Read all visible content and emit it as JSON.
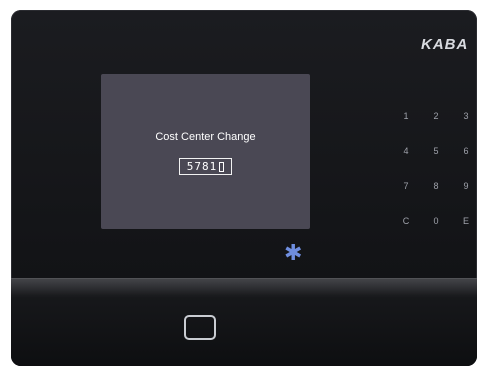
{
  "brand": {
    "logo_text": "KABA"
  },
  "screen": {
    "title": "Cost Center Change",
    "code_value": "5781"
  },
  "keypad": {
    "keys": [
      "1",
      "2",
      "3",
      "4",
      "5",
      "6",
      "7",
      "8",
      "9",
      "C",
      "0",
      "E"
    ]
  },
  "icons": {
    "star": "asterisk-icon",
    "reader": "rfid-reader-icon"
  },
  "colors": {
    "body": "#141518",
    "screen": "#4a4854",
    "star": "#6f8ee0"
  }
}
